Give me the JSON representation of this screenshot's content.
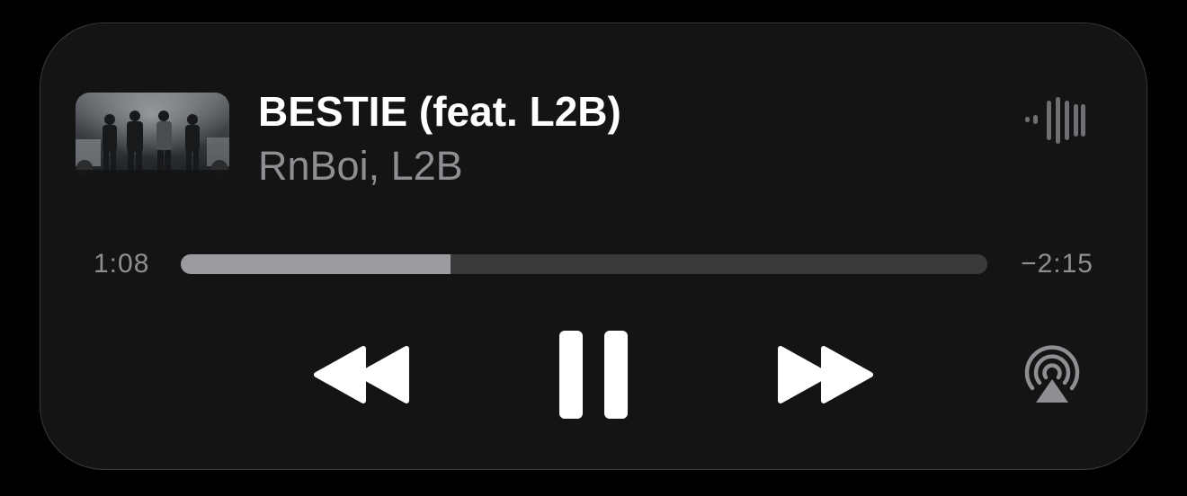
{
  "now_playing": {
    "title": "BESTIE (feat. L2B)",
    "artist": "RnBoi, L2B"
  },
  "playback": {
    "elapsed": "1:08",
    "remaining": "−2:15",
    "progress_fraction": 0.335,
    "state": "playing"
  },
  "icons": {
    "waveform": "waveform-icon",
    "rewind": "backward-icon",
    "pause": "pause-icon",
    "forward": "forward-icon",
    "airplay": "airplay-icon"
  },
  "colors": {
    "background": "#141414",
    "title": "#ffffff",
    "secondary_text": "#8e8e93",
    "progress_fill": "#9a9a9f",
    "progress_track": "#3a3a3c"
  }
}
